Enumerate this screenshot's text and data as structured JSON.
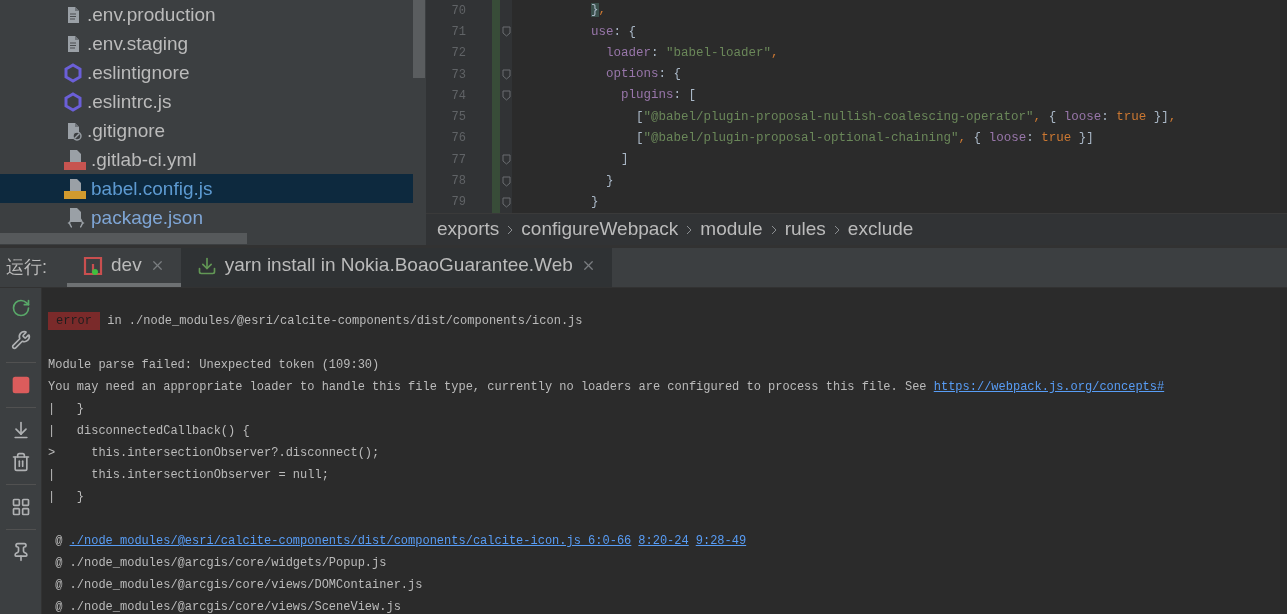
{
  "project_tree": {
    "items": [
      {
        "name": ".env.production",
        "kind": "text",
        "color": "#bbbbbb",
        "selected": false
      },
      {
        "name": ".env.staging",
        "kind": "text",
        "color": "#bbbbbb",
        "selected": false
      },
      {
        "name": ".eslintignore",
        "kind": "eslint",
        "color": "#bbbbbb",
        "selected": false
      },
      {
        "name": ".eslintrc.js",
        "kind": "eslint",
        "color": "#bbbbbb",
        "selected": false
      },
      {
        "name": ".gitignore",
        "kind": "ignore",
        "color": "#bbbbbb",
        "selected": false
      },
      {
        "name": ".gitlab-ci.yml",
        "kind": "yml",
        "color": "#bbbbbb",
        "selected": false
      },
      {
        "name": "babel.config.js",
        "kind": "js",
        "color": "#5d9ad1",
        "selected": true
      },
      {
        "name": "package.json",
        "kind": "json",
        "color": "#7fa6d6",
        "selected": false
      }
    ]
  },
  "editor": {
    "lines": [
      {
        "number": "70",
        "fold": false,
        "segments": [
          {
            "kind": "brace",
            "text": "        }"
          },
          {
            "kind": "punct",
            "text": ","
          }
        ]
      },
      {
        "number": "71",
        "fold": true,
        "segments": [
          {
            "kind": "key",
            "text": "        use"
          },
          {
            "kind": "plain",
            "text": ": {"
          }
        ]
      },
      {
        "number": "72",
        "fold": false,
        "segments": [
          {
            "kind": "key",
            "text": "          loader"
          },
          {
            "kind": "plain",
            "text": ": "
          },
          {
            "kind": "string",
            "text": "\"babel-loader\""
          },
          {
            "kind": "punct",
            "text": ","
          }
        ]
      },
      {
        "number": "73",
        "fold": true,
        "segments": [
          {
            "kind": "key",
            "text": "          options"
          },
          {
            "kind": "plain",
            "text": ": {"
          }
        ]
      },
      {
        "number": "74",
        "fold": true,
        "segments": [
          {
            "kind": "key",
            "text": "            plugins"
          },
          {
            "kind": "plain",
            "text": ": ["
          }
        ]
      },
      {
        "number": "75",
        "fold": false,
        "segments": [
          {
            "kind": "plain",
            "text": "              ["
          },
          {
            "kind": "string",
            "text": "\"@babel/plugin-proposal-nullish-coalescing-operator\""
          },
          {
            "kind": "punct",
            "text": ","
          },
          {
            "kind": "plain",
            "text": " { "
          },
          {
            "kind": "key",
            "text": "loose"
          },
          {
            "kind": "plain",
            "text": ": "
          },
          {
            "kind": "keyword",
            "text": "true"
          },
          {
            "kind": "plain",
            "text": " }]"
          },
          {
            "kind": "punct",
            "text": ","
          }
        ]
      },
      {
        "number": "76",
        "fold": false,
        "segments": [
          {
            "kind": "plain",
            "text": "              ["
          },
          {
            "kind": "string",
            "text": "\"@babel/plugin-proposal-optional-chaining\""
          },
          {
            "kind": "punct",
            "text": ","
          },
          {
            "kind": "plain",
            "text": " { "
          },
          {
            "kind": "key",
            "text": "loose"
          },
          {
            "kind": "plain",
            "text": ": "
          },
          {
            "kind": "keyword",
            "text": "true"
          },
          {
            "kind": "plain",
            "text": " }]"
          }
        ]
      },
      {
        "number": "77",
        "fold": true,
        "segments": [
          {
            "kind": "plain",
            "text": "            ]"
          }
        ]
      },
      {
        "number": "78",
        "fold": true,
        "segments": [
          {
            "kind": "plain",
            "text": "          }"
          }
        ]
      },
      {
        "number": "79",
        "fold": true,
        "segments": [
          {
            "kind": "plain",
            "text": "        }"
          }
        ]
      }
    ],
    "breadcrumbs": [
      "exports",
      "configureWebpack",
      "module",
      "rules",
      "exclude"
    ]
  },
  "run_panel": {
    "label": "运行:",
    "tabs": [
      {
        "title": "dev",
        "kind": "npm",
        "selected": true
      },
      {
        "title": "yarn install in Nokia.BoaoGuarantee.Web",
        "kind": "install",
        "selected": false
      }
    ]
  },
  "console": {
    "lines": [
      {
        "kind": "error",
        "badge": "error",
        "text": " in ./node_modules/@esri/calcite-components/dist/components/icon.js"
      },
      {
        "kind": "blank"
      },
      {
        "kind": "text",
        "text": "Module parse failed: Unexpected token (109:30)"
      },
      {
        "kind": "text",
        "text": "You may need an appropriate loader to handle this file type, currently no loaders are configured to process this file. See ",
        "link": "https://webpack.js.org/concepts#"
      },
      {
        "kind": "text",
        "text": "|   }"
      },
      {
        "kind": "text",
        "text": "|   disconnectedCallback() {"
      },
      {
        "kind": "text",
        "text": ">     this.intersectionObserver?.disconnect();"
      },
      {
        "kind": "text",
        "text": "|     this.intersectionObserver = null;"
      },
      {
        "kind": "text",
        "text": "|   }"
      },
      {
        "kind": "blank"
      },
      {
        "kind": "trace",
        "text": " @ ",
        "links": [
          "./node_modules/@esri/calcite-components/dist/components/calcite-icon.js 6:0-66",
          "8:20-24",
          "9:28-49"
        ]
      },
      {
        "kind": "text",
        "text": " @ ./node_modules/@arcgis/core/widgets/Popup.js"
      },
      {
        "kind": "text",
        "text": " @ ./node_modules/@arcgis/core/views/DOMContainer.js"
      },
      {
        "kind": "text",
        "text": " @ ./node_modules/@arcgis/core/views/SceneView.js"
      }
    ]
  }
}
